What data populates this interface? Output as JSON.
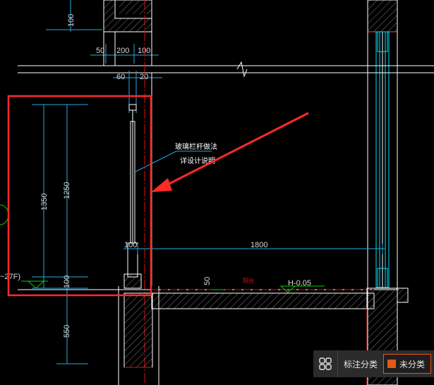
{
  "drawing": {
    "dims_top": {
      "d100_vertical": "100",
      "d50": "50",
      "d200": "200",
      "d100": "100"
    },
    "dims_upper": {
      "d60": "60",
      "d20": "20"
    },
    "dims_left": {
      "d1350": "1350",
      "d1250": "1250",
      "d100": "100",
      "d550": "550"
    },
    "dims_floor": {
      "d100": "100",
      "d1800": "1800",
      "d50": "50"
    },
    "level_label": "H-0.05",
    "floor_tag": "阳台",
    "left_edge_label": "~27F)",
    "callout": {
      "line1": "玻璃栏杆做法",
      "line2": "详设计说明"
    },
    "colors": {
      "dimension": "#2aa7e0",
      "wall": "#ffffff",
      "hatch": "#b0b0b0",
      "highlight_box": "#ff2a2a",
      "arrow": "#ff2a2a",
      "cyan": "#00e5ff",
      "green": "#00d000",
      "axis": "#e01010"
    }
  },
  "toolbar": {
    "grid_icon": "grid-icon",
    "category_label": "标注分类",
    "unclassified_label": "未分类",
    "unclassified_color": "#e4571b"
  }
}
